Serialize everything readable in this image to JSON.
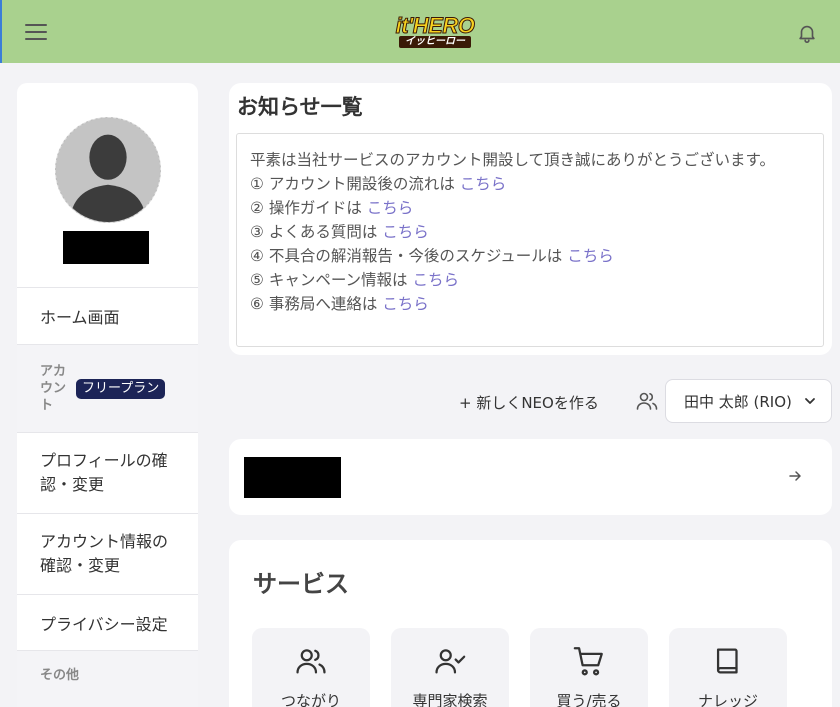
{
  "header": {
    "logo_main": "it'HERO",
    "logo_sub": "イッヒーロー"
  },
  "sidebar": {
    "items": [
      {
        "label": "ホーム画面"
      },
      {
        "category": "アカウント",
        "badge": "フリープラン"
      },
      {
        "label": "プロフィールの確認・変更"
      },
      {
        "label": "アカウント情報の確認・変更"
      },
      {
        "label": "プライバシー設定"
      },
      {
        "category": "その他"
      }
    ]
  },
  "notice": {
    "title": "お知らせ一覧",
    "intro": "平素は当社サービスのアカウント開設して頂き誠にありがとうございます。",
    "link_text": "こちら",
    "lines": [
      "① アカウント開設後の流れは",
      "② 操作ガイドは",
      "③ よくある質問は",
      "④ 不具合の解消報告・今後のスケジュールは",
      "⑤ キャンペーン情報は",
      "⑥ 事務局へ連絡は"
    ]
  },
  "actions": {
    "new_neo": "+ 新しくNEOを作る",
    "user_name": "田中 太郎 (RIO)"
  },
  "services": {
    "title": "サービス",
    "tiles": [
      {
        "label": "つながり",
        "icon": "users-icon"
      },
      {
        "label": "専門家検索",
        "icon": "user-check-icon"
      },
      {
        "label": "買う/売る",
        "icon": "cart-icon"
      },
      {
        "label": "ナレッジ",
        "icon": "book-icon"
      }
    ]
  },
  "colors": {
    "header_bg": "#a9d18e",
    "link": "#7a72c9",
    "badge_bg": "#1c2457"
  }
}
